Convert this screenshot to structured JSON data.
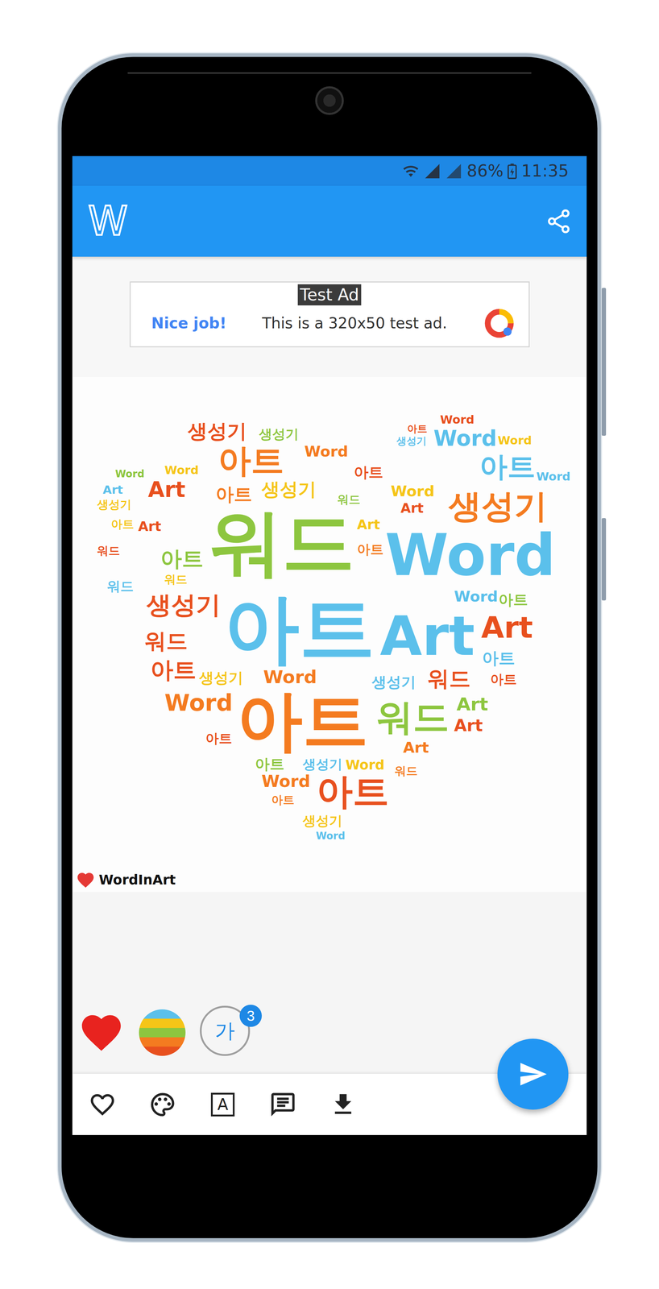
{
  "status_bar": {
    "battery": "86%",
    "time": "11:35"
  },
  "app_bar": {
    "logo": "W"
  },
  "ad": {
    "label": "Test Ad",
    "headline": "Nice job!",
    "body": "This is a 320x50 test ad."
  },
  "word_cloud": {
    "words": [
      {
        "text": "워드",
        "color": "#8dc63f"
      },
      {
        "text": "Word",
        "color": "#5bc0eb"
      },
      {
        "text": "아트",
        "color": "#5bc0eb"
      },
      {
        "text": "Art",
        "color": "#5bc0eb"
      },
      {
        "text": "아트",
        "color": "#f47b20"
      },
      {
        "text": "워드",
        "color": "#8dc63f"
      },
      {
        "text": "생성기",
        "color": "#f47b20"
      },
      {
        "text": "아트",
        "color": "#5bc0eb"
      },
      {
        "text": "아트",
        "color": "#f47b20"
      },
      {
        "text": "생성기",
        "color": "#e8501e"
      },
      {
        "text": "Art",
        "color": "#e8501e"
      },
      {
        "text": "Word",
        "color": "#f5c518"
      },
      {
        "text": "생성기",
        "color": "#f5c518"
      },
      {
        "text": "아트",
        "color": "#f47b20"
      },
      {
        "text": "아트",
        "color": "#8dc63f"
      },
      {
        "text": "생성기",
        "color": "#e8501e"
      },
      {
        "text": "워드",
        "color": "#e8501e"
      },
      {
        "text": "아트",
        "color": "#e8501e"
      },
      {
        "text": "Word",
        "color": "#f47b20"
      },
      {
        "text": "생성기",
        "color": "#f5c518"
      },
      {
        "text": "Word",
        "color": "#f47b20"
      },
      {
        "text": "생성기",
        "color": "#5bc0eb"
      },
      {
        "text": "Art",
        "color": "#e8501e"
      },
      {
        "text": "아트",
        "color": "#5bc0eb"
      },
      {
        "text": "워드",
        "color": "#e8501e"
      },
      {
        "text": "Art",
        "color": "#8dc63f"
      },
      {
        "text": "Art",
        "color": "#e8501e"
      },
      {
        "text": "아트",
        "color": "#e8501e"
      },
      {
        "text": "Word",
        "color": "#f47b20"
      },
      {
        "text": "생성기",
        "color": "#f5c518"
      },
      {
        "text": "Word",
        "color": "#5bc0eb"
      },
      {
        "text": "Word",
        "color": "#f5c518"
      },
      {
        "text": "생성기",
        "color": "#5bc0eb"
      },
      {
        "text": "아트",
        "color": "#8dc63f"
      },
      {
        "text": "Word",
        "color": "#5bc0eb"
      },
      {
        "text": "Word",
        "color": "#e8501e"
      },
      {
        "text": "Word",
        "color": "#f5c518"
      },
      {
        "text": "생성기",
        "color": "#5bc0eb"
      },
      {
        "text": "아트",
        "color": "#e8501e"
      },
      {
        "text": "Word",
        "color": "#f5c518"
      },
      {
        "text": "Art",
        "color": "#e8501e"
      },
      {
        "text": "Word",
        "color": "#5bc0eb"
      },
      {
        "text": "Art",
        "color": "#f5c518"
      },
      {
        "text": "아트",
        "color": "#f47b20"
      },
      {
        "text": "아트",
        "color": "#8dc63f"
      },
      {
        "text": "아트",
        "color": "#e8501e"
      },
      {
        "text": "워드",
        "color": "#f5c518"
      },
      {
        "text": "생성기",
        "color": "#f5c518"
      },
      {
        "text": "Art",
        "color": "#5bc0eb"
      },
      {
        "text": "Word",
        "color": "#8dc63f"
      },
      {
        "text": "아트",
        "color": "#f5c518"
      },
      {
        "text": "워드",
        "color": "#e8501e"
      },
      {
        "text": "Art",
        "color": "#e8501e"
      },
      {
        "text": "워드",
        "color": "#5bc0eb"
      },
      {
        "text": "Word",
        "color": "#5bc0eb"
      },
      {
        "text": "워드",
        "color": "#8dc63f"
      },
      {
        "text": "생성기",
        "color": "#8dc63f"
      },
      {
        "text": "Word",
        "color": "#f47b20"
      },
      {
        "text": "아트",
        "color": "#e8501e"
      },
      {
        "text": "아트",
        "color": "#f47b20"
      },
      {
        "text": "Art",
        "color": "#f47b20"
      },
      {
        "text": "워드",
        "color": "#f47b20"
      },
      {
        "text": "아트",
        "color": "#e8501e"
      }
    ]
  },
  "watermark": {
    "text": "WordInArt"
  },
  "options": {
    "palette": {
      "colors": [
        "#5bc0eb",
        "#f5c518",
        "#8dc63f",
        "#f47b20",
        "#e8501e"
      ]
    },
    "font": {
      "text": "가",
      "badge": "3"
    }
  },
  "toolbar": {
    "font_glyph": "A"
  }
}
